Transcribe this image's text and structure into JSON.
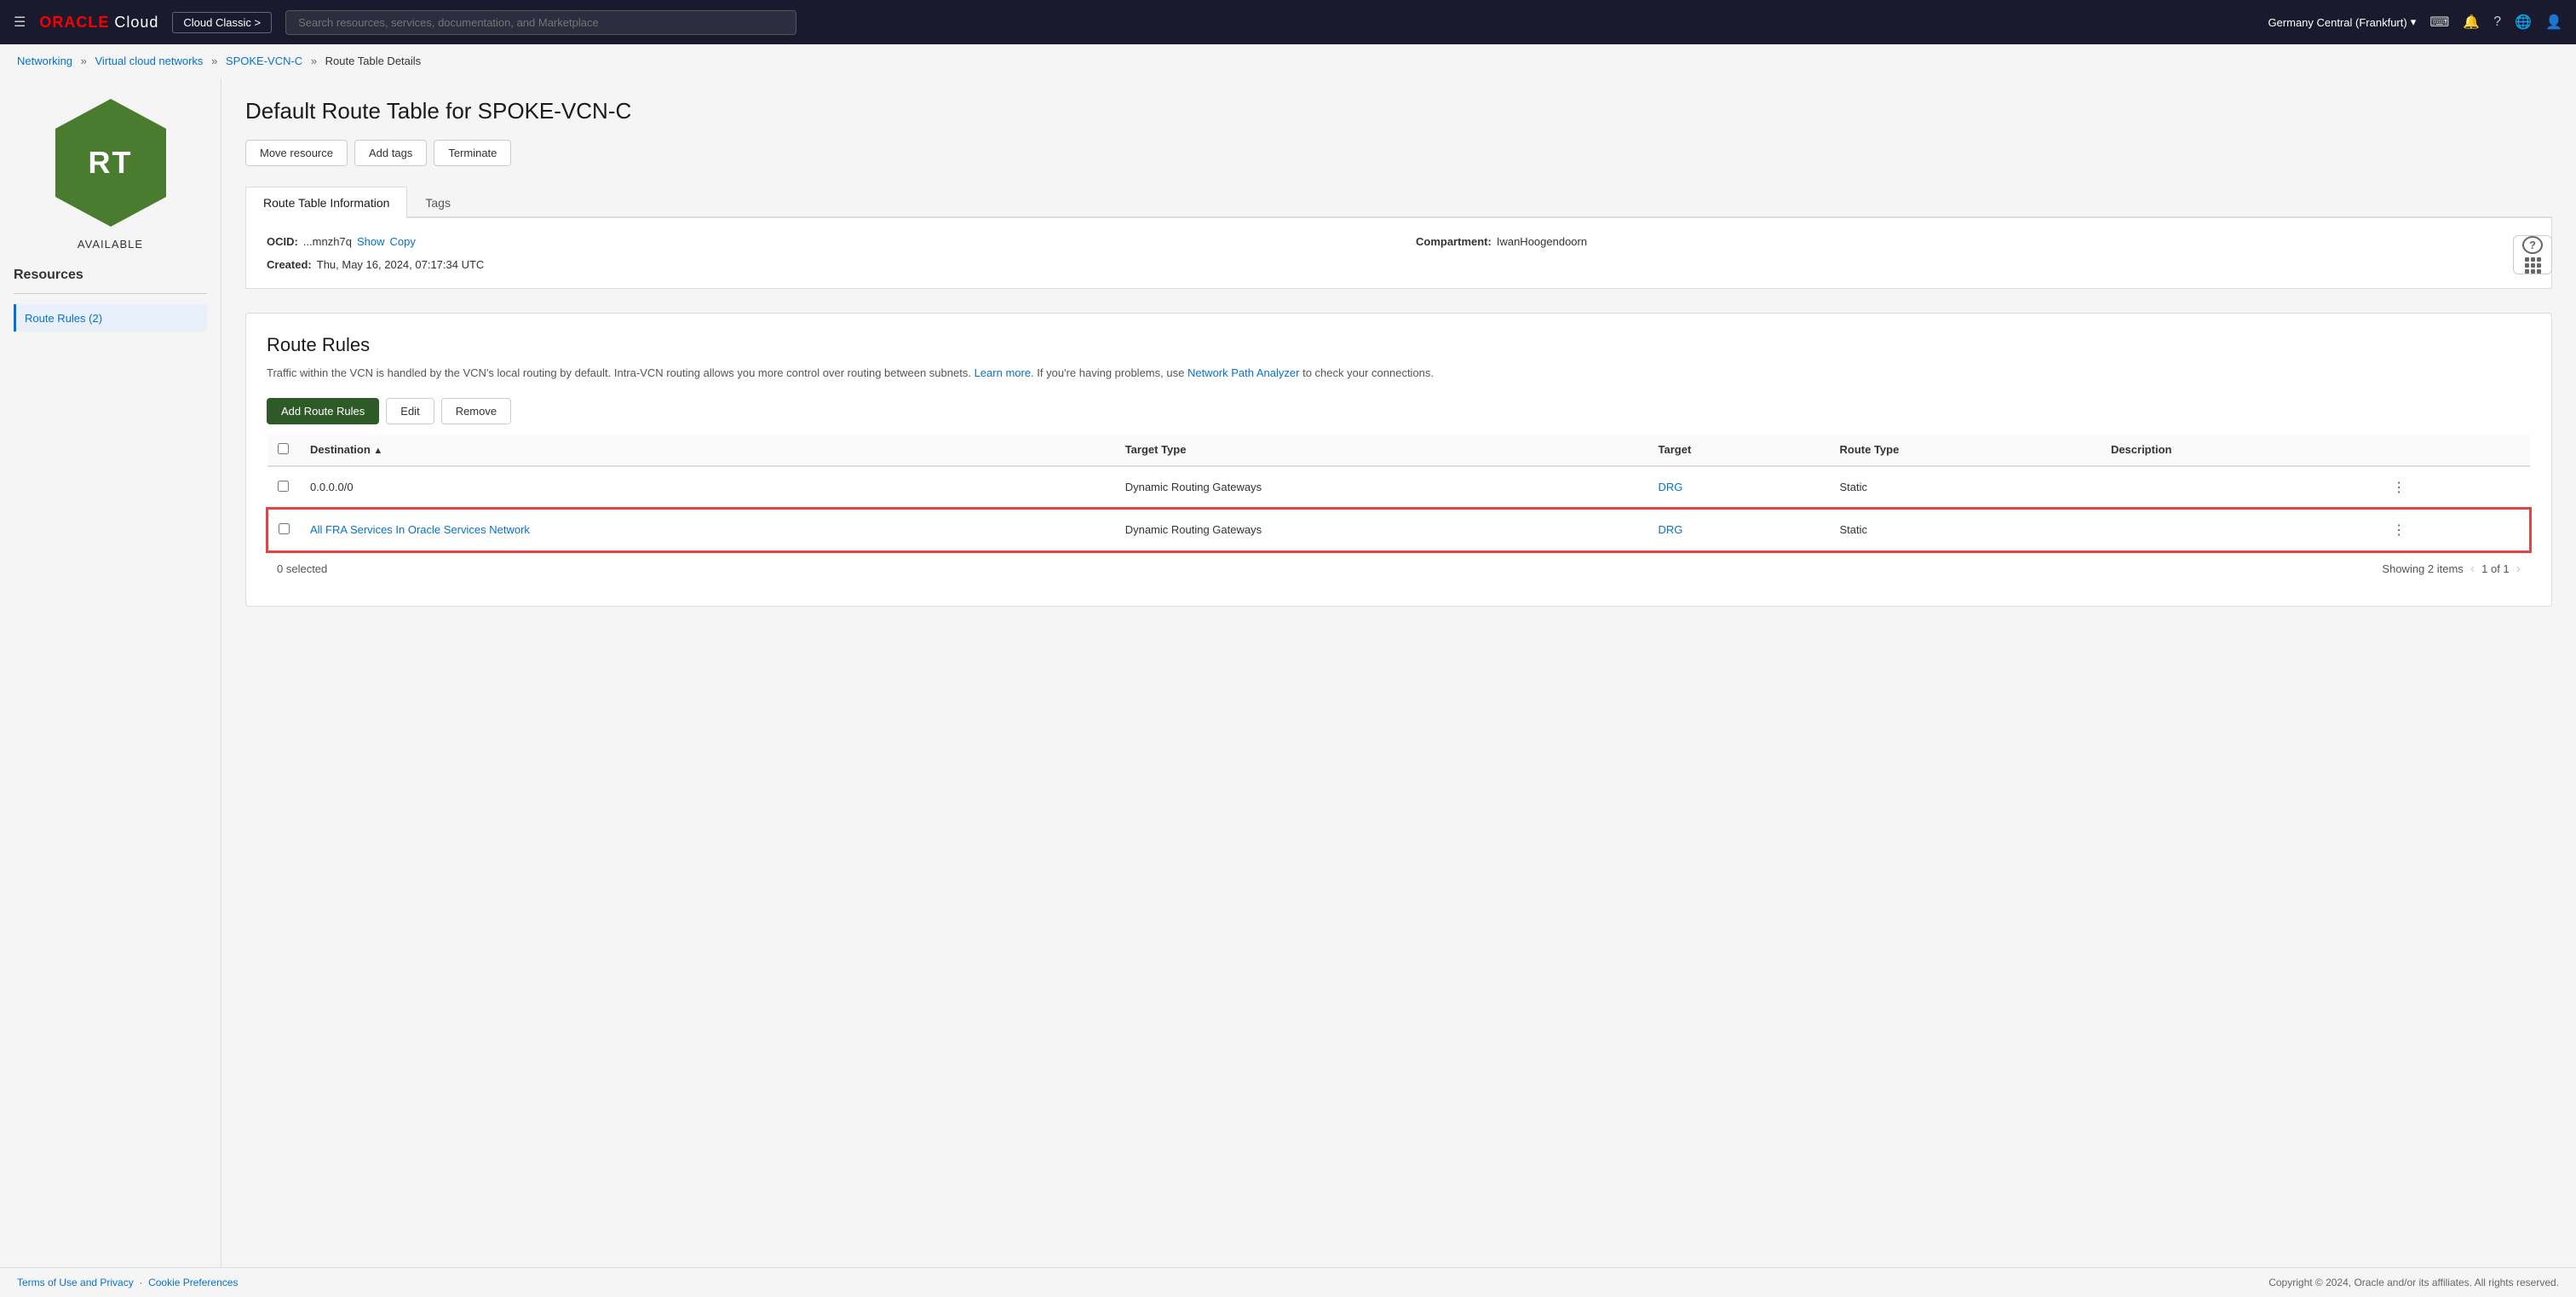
{
  "navbar": {
    "hamburger_label": "☰",
    "oracle_text": "ORACLE",
    "cloud_text": "Cloud",
    "cloud_classic_btn": "Cloud Classic >",
    "search_placeholder": "Search resources, services, documentation, and Marketplace",
    "region": "Germany Central (Frankfurt)",
    "region_arrow": "▾",
    "icons": {
      "code": "⌨",
      "bell": "🔔",
      "help": "?",
      "globe": "🌐",
      "user": "👤"
    }
  },
  "breadcrumb": {
    "networking": "Networking",
    "vcn": "Virtual cloud networks",
    "spoke": "SPOKE-VCN-C",
    "current": "Route Table Details"
  },
  "page": {
    "title": "Default Route Table for SPOKE-VCN-C",
    "status": "AVAILABLE",
    "hex_label": "RT"
  },
  "action_buttons": {
    "move_resource": "Move resource",
    "add_tags": "Add tags",
    "terminate": "Terminate"
  },
  "tabs": [
    {
      "id": "route-info",
      "label": "Route Table Information",
      "active": true
    },
    {
      "id": "tags",
      "label": "Tags",
      "active": false
    }
  ],
  "info": {
    "ocid_label": "OCID:",
    "ocid_value": "...mnzh7q",
    "ocid_show": "Show",
    "ocid_copy": "Copy",
    "compartment_label": "Compartment:",
    "compartment_value": "IwanHoogendoorn",
    "created_label": "Created:",
    "created_value": "Thu, May 16, 2024, 07:17:34 UTC"
  },
  "route_rules": {
    "section_title": "Route Rules",
    "description_text": "Traffic within the VCN is handled by the VCN's local routing by default. Intra-VCN routing allows you more control over routing between subnets.",
    "learn_more": "Learn more.",
    "description_text2": "If you're having problems, use",
    "network_path": "Network Path Analyzer",
    "description_text3": "to check your connections.",
    "add_route_rules_btn": "Add Route Rules",
    "edit_btn": "Edit",
    "remove_btn": "Remove",
    "columns": [
      {
        "id": "destination",
        "label": "Destination",
        "sortable": true
      },
      {
        "id": "target_type",
        "label": "Target Type"
      },
      {
        "id": "target",
        "label": "Target"
      },
      {
        "id": "route_type",
        "label": "Route Type"
      },
      {
        "id": "description",
        "label": "Description"
      }
    ],
    "rows": [
      {
        "id": "row1",
        "destination": "0.0.0.0/0",
        "destination_link": false,
        "target_type": "Dynamic Routing Gateways",
        "target": "DRG",
        "target_link": true,
        "route_type": "Static",
        "description": "",
        "highlighted": false
      },
      {
        "id": "row2",
        "destination": "All FRA Services In Oracle Services Network",
        "destination_link": true,
        "target_type": "Dynamic Routing Gateways",
        "target": "DRG",
        "target_link": true,
        "route_type": "Static",
        "description": "",
        "highlighted": true
      }
    ],
    "footer": {
      "selected": "0 selected",
      "showing": "Showing 2 items",
      "page_info": "1 of 1"
    }
  },
  "resources": {
    "title": "Resources",
    "items": [
      {
        "label": "Route Rules (2)",
        "active": true
      }
    ]
  },
  "footer": {
    "terms": "Terms of Use and Privacy",
    "cookies": "Cookie Preferences",
    "copyright": "Copyright © 2024, Oracle and/or its affiliates. All rights reserved."
  }
}
